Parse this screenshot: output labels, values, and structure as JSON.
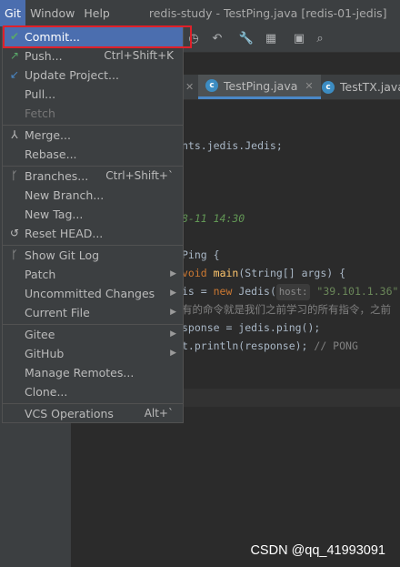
{
  "menubar": {
    "items": [
      "Git",
      "Window",
      "Help"
    ],
    "title": "redis-study - TestPing.java [redis-01-jedis]"
  },
  "tabs": [
    {
      "label": "TestPing.java"
    },
    {
      "label": "TestTX.java"
    }
  ],
  "code": {
    "l1": "nts.jedis.Jedis;",
    "l2": "8-11 14:30",
    "l3": "Ping {",
    "l4a": "void",
    "l4b": "main",
    "l4c": "(String[] args) {",
    "l5a": "is = ",
    "l5b": "new",
    "l5c": " Jedis(",
    "l5hint": "host:",
    "l5str": " \"39.101.1.36\"",
    "l6": "有的命令就是我们之前学习的所有指令，之前",
    "l7": "sponse = jedis.ping();",
    "l8a": "t.println(response); ",
    "l8b": "// PONG"
  },
  "git_menu": {
    "items": [
      {
        "label": "Commit...",
        "shortcut": "",
        "icon": "check-icon"
      },
      {
        "label": "Push...",
        "shortcut": "Ctrl+Shift+K",
        "icon": "push-arrow-icon"
      },
      {
        "label": "Update Project...",
        "shortcut": "",
        "icon": "update-arrow-icon"
      },
      {
        "label": "Pull...",
        "shortcut": "",
        "icon": ""
      },
      {
        "label": "Fetch",
        "shortcut": "",
        "icon": ""
      },
      {
        "label": "Merge...",
        "shortcut": "",
        "icon": "merge-icon"
      },
      {
        "label": "Rebase...",
        "shortcut": "",
        "icon": ""
      },
      {
        "label": "Branches...",
        "shortcut": "Ctrl+Shift+`",
        "icon": "branch-icon"
      },
      {
        "label": "New Branch...",
        "shortcut": "",
        "icon": ""
      },
      {
        "label": "New Tag...",
        "shortcut": "",
        "icon": ""
      },
      {
        "label": "Reset HEAD...",
        "shortcut": "",
        "icon": "reset-icon"
      },
      {
        "label": "Show Git Log",
        "shortcut": "",
        "icon": "git-log-icon"
      },
      {
        "label": "Patch",
        "shortcut": "",
        "icon": ""
      },
      {
        "label": "Uncommitted Changes",
        "shortcut": "",
        "icon": ""
      },
      {
        "label": "Current File",
        "shortcut": "",
        "icon": ""
      },
      {
        "label": "Gitee",
        "shortcut": "",
        "icon": ""
      },
      {
        "label": "GitHub",
        "shortcut": "",
        "icon": ""
      },
      {
        "label": "Manage Remotes...",
        "shortcut": "",
        "icon": ""
      },
      {
        "label": "Clone...",
        "shortcut": "",
        "icon": ""
      },
      {
        "label": "VCS Operations",
        "shortcut": "Alt+`",
        "icon": ""
      }
    ]
  },
  "watermark": "CSDN @qq_41993091",
  "colors": {
    "highlight": "#4b6eaf",
    "annotation": "#e0202a"
  }
}
